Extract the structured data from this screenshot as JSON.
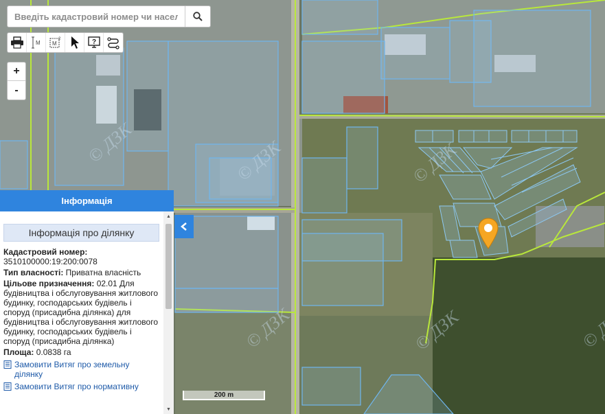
{
  "search": {
    "placeholder": "Введіть кадастровий номер чи населений пункт",
    "search_icon": "search-icon"
  },
  "toolbar": {
    "tools": [
      "print-icon",
      "measure-distance-icon",
      "measure-area-icon",
      "pointer-icon",
      "info-help-icon",
      "route-icon"
    ]
  },
  "zoom": {
    "in_label": "+",
    "out_label": "-"
  },
  "panel": {
    "header": "Інформація",
    "subtitle": "Інформація про ділянку",
    "cadastral_label": "Кадастровий номер:",
    "cadastral_value": "3510100000:19:200:0078",
    "ownership_label": "Тип власності:",
    "ownership_value": "Приватна власність",
    "purpose_label": "Цільове призначення:",
    "purpose_value": "02.01 Для будівництва і обслуговування житлового будинку, господарських будівель і споруд (присадибна ділянка) для будівництва і обслуговування житлового будинку, господарських будівель і споруд (присадибна ділянка)",
    "area_label": "Площа:",
    "area_value": "0.0838 га",
    "link1": "Замовити Витяг про земельну ділянку",
    "link2": "Замовити Витяг про нормативну"
  },
  "map": {
    "scale_label": "200 m",
    "watermark": "© ДЗК",
    "colors": {
      "parcel_outline": "#6fb6ee",
      "boundary_line": "#b9e83b",
      "marker": "#f5a623",
      "panel_header": "#2f84de"
    }
  }
}
